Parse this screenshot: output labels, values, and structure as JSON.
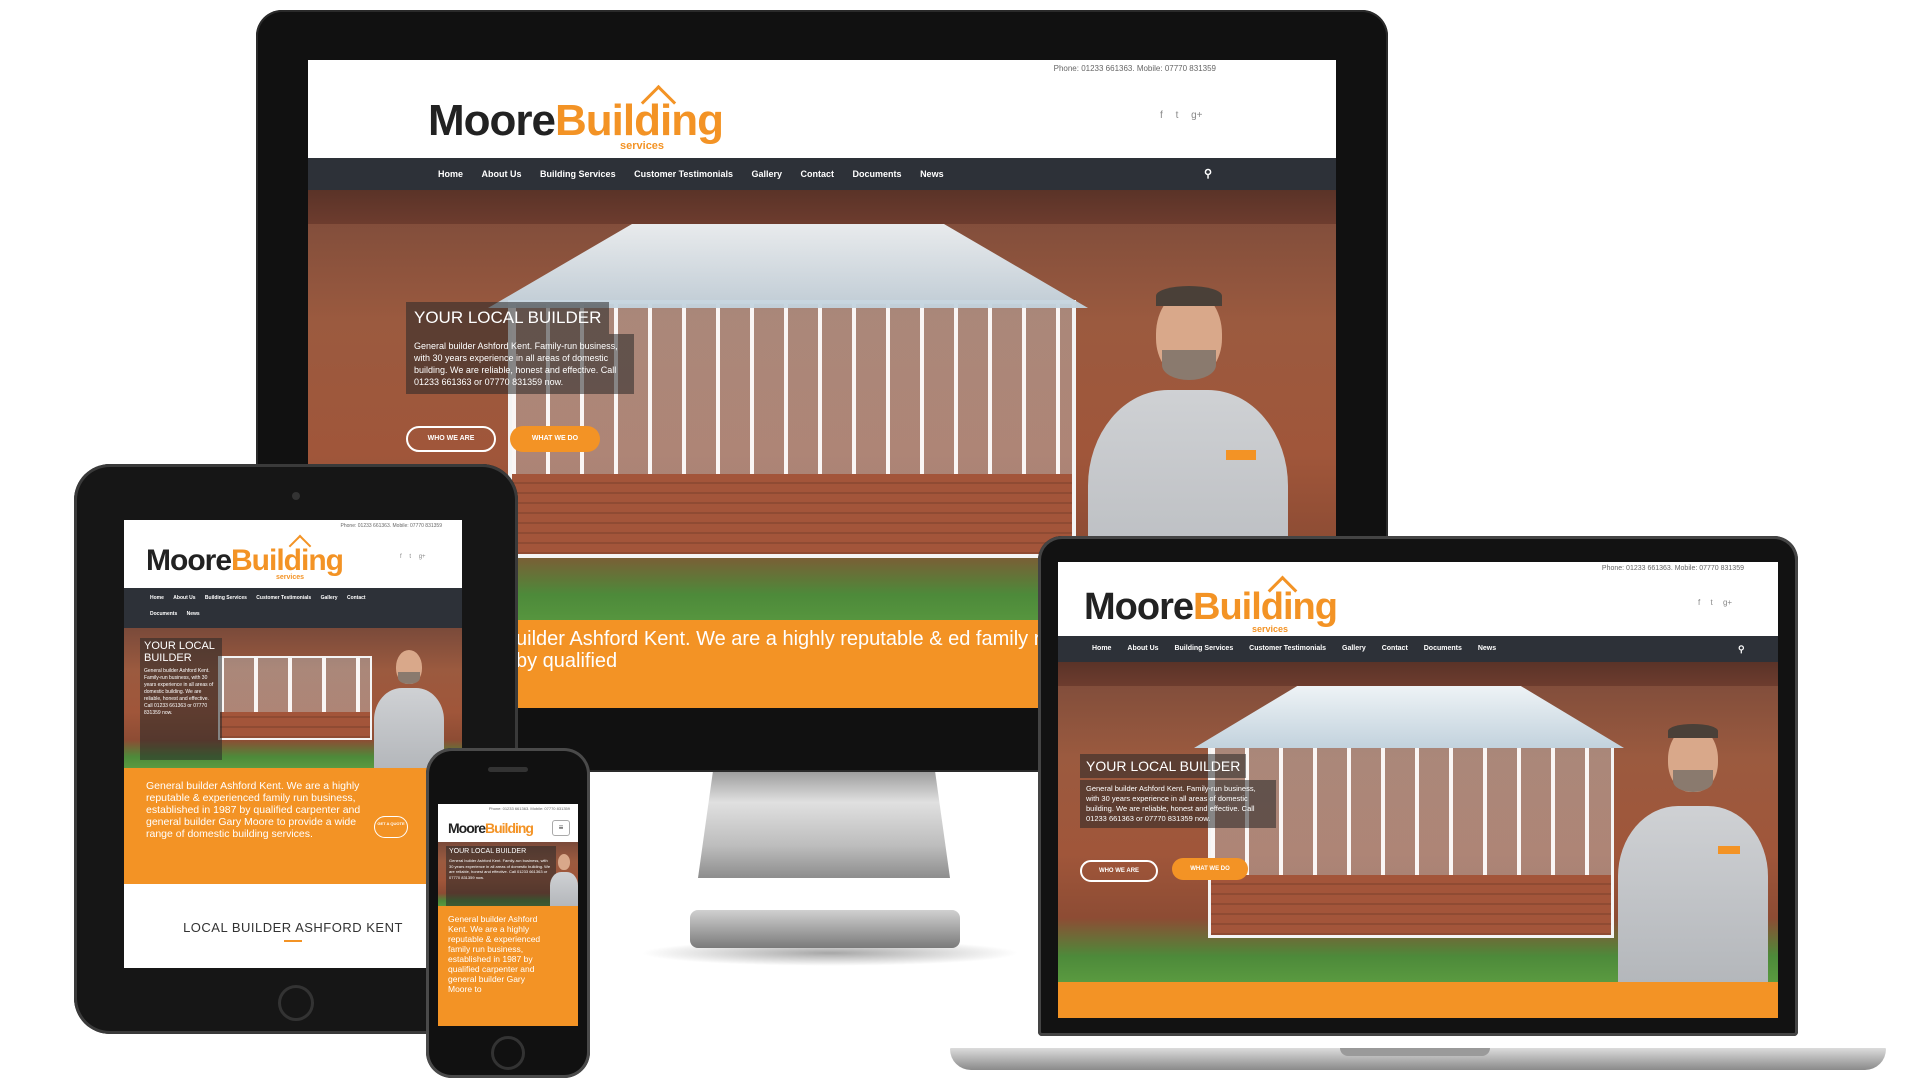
{
  "site": {
    "phone_line": "Phone: 01233 661363. Mobile: 07770 831359",
    "logo_moore": "Moore",
    "logo_building": "Building",
    "logo_sub": "services",
    "social": [
      "f",
      "t",
      "g+"
    ],
    "nav": [
      "Home",
      "About Us",
      "Building Services",
      "Customer Testimonials",
      "Gallery",
      "Contact",
      "Documents",
      "News"
    ],
    "hero_title": "YOUR LOCAL BUILDER",
    "hero_text": "General builder Ashford Kent. Family-run business, with 30 years experience in all areas of domestic building. We are reliable, honest and effective. Call 01233 661363 or 07770 831359 now.",
    "btn_who": "WHO WE ARE",
    "btn_what": "WHAT WE DO",
    "intro_text": "General builder Ashford Kent. We are a highly reputable & experienced family run business, established in 1987 by qualified carpenter and general builder Gary Moore to provide a wide range of domestic building services.",
    "imac_band_text": "uilder Ashford Kent. We are a highly reputable & ed family run business, established in 1987 by qualified",
    "tablet_hero_title": "YOUR LOCAL BUILDER",
    "tablet_hero_text": "General builder Ashford Kent. Family-run business, with 30 years experience in all areas of domestic building. We are reliable, honest and effective. Call 01233 661363 or 07770 831359 now.",
    "get_quote": "GET A QUOTE",
    "section_heading": "LOCAL BUILDER ASHFORD KENT",
    "phone_band_text": "General builder Ashford Kent. We are a highly reputable & experienced family run business, established in 1987 by qualified carpenter and general builder Gary Moore to",
    "phone_hero_text": "General builder Ashford Kent. Family-run business, with 30 years experience in all areas of domestic building. We are reliable, honest and effective. Call 01233 661363 or 07770 831359 now."
  },
  "colors": {
    "accent": "#f39325",
    "nav_bg": "#2d3138"
  }
}
